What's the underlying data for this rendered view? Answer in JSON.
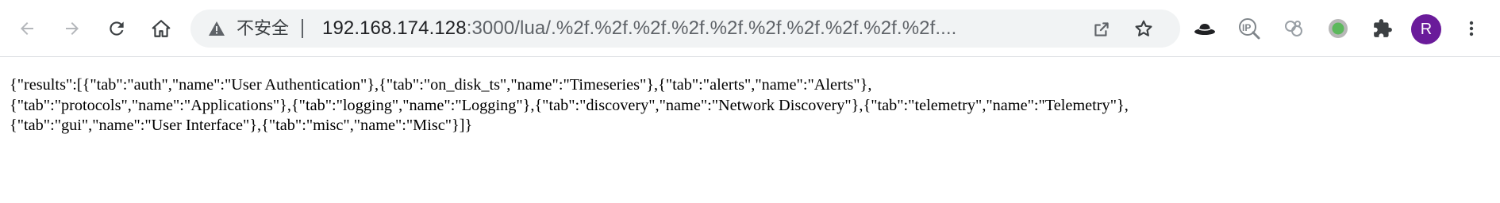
{
  "browser": {
    "security_label": "不安全",
    "url_host": "192.168.174.128",
    "url_rest": ":3000/lua/.%2f.%2f.%2f.%2f.%2f.%2f.%2f.%2f.%2f.%2f....",
    "avatar_letter": "R",
    "accent_color": "#6a1b9a",
    "icons": [
      "back-icon",
      "forward-icon",
      "reload-icon",
      "home-icon",
      "warning-icon",
      "share-icon",
      "star-icon",
      "hat-extension-icon",
      "ip-extension-icon",
      "link-extension-icon",
      "green-dot-extension-icon",
      "puzzle-icon",
      "more-vert-icon"
    ]
  },
  "page": {
    "lines": [
      "{\"results\":[{\"tab\":\"auth\",\"name\":\"User Authentication\"},{\"tab\":\"on_disk_ts\",\"name\":\"Timeseries\"},{\"tab\":\"alerts\",\"name\":\"Alerts\"},",
      "{\"tab\":\"protocols\",\"name\":\"Applications\"},{\"tab\":\"logging\",\"name\":\"Logging\"},{\"tab\":\"discovery\",\"name\":\"Network Discovery\"},{\"tab\":\"telemetry\",\"name\":\"Telemetry\"},",
      "{\"tab\":\"gui\",\"name\":\"User Interface\"},{\"tab\":\"misc\",\"name\":\"Misc\"}]}"
    ]
  }
}
